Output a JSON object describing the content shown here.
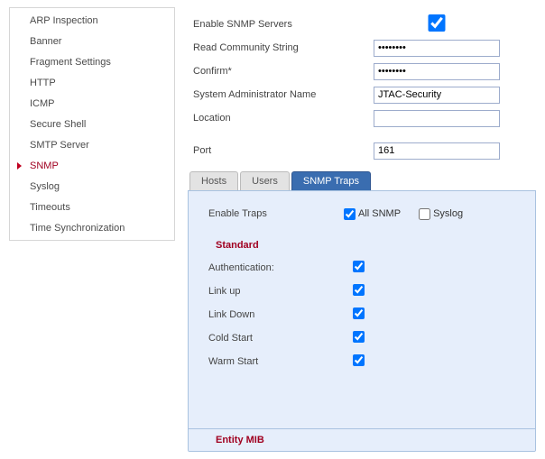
{
  "sidebar": {
    "items": [
      {
        "label": "ARP Inspection",
        "active": false
      },
      {
        "label": "Banner",
        "active": false
      },
      {
        "label": "Fragment Settings",
        "active": false
      },
      {
        "label": "HTTP",
        "active": false
      },
      {
        "label": "ICMP",
        "active": false
      },
      {
        "label": "Secure Shell",
        "active": false
      },
      {
        "label": "SMTP Server",
        "active": false
      },
      {
        "label": "SNMP",
        "active": true
      },
      {
        "label": "Syslog",
        "active": false
      },
      {
        "label": "Timeouts",
        "active": false
      },
      {
        "label": "Time Synchronization",
        "active": false
      }
    ]
  },
  "form": {
    "enable_label": "Enable SNMP Servers",
    "enable_checked": true,
    "community_label": "Read Community String",
    "community_value": "••••••••",
    "confirm_label": "Confirm*",
    "confirm_value": "••••••••",
    "admin_label": "System Administrator Name",
    "admin_value": "JTAC-Security",
    "location_label": "Location",
    "location_value": "",
    "port_label": "Port",
    "port_value": "161"
  },
  "tabs": {
    "items": [
      {
        "label": "Hosts",
        "active": false
      },
      {
        "label": "Users",
        "active": false
      },
      {
        "label": "SNMP Traps",
        "active": true
      }
    ]
  },
  "traps_panel": {
    "enable_label": "Enable Traps",
    "allsnmp_label": "All SNMP",
    "allsnmp_checked": true,
    "syslog_label": "Syslog",
    "syslog_checked": false,
    "standard_title": "Standard",
    "rows": [
      {
        "label": "Authentication:",
        "checked": true
      },
      {
        "label": "Link up",
        "checked": true
      },
      {
        "label": "Link Down",
        "checked": true
      },
      {
        "label": "Cold Start",
        "checked": true
      },
      {
        "label": "Warm Start",
        "checked": true
      }
    ],
    "entity_title": "Entity MIB"
  }
}
